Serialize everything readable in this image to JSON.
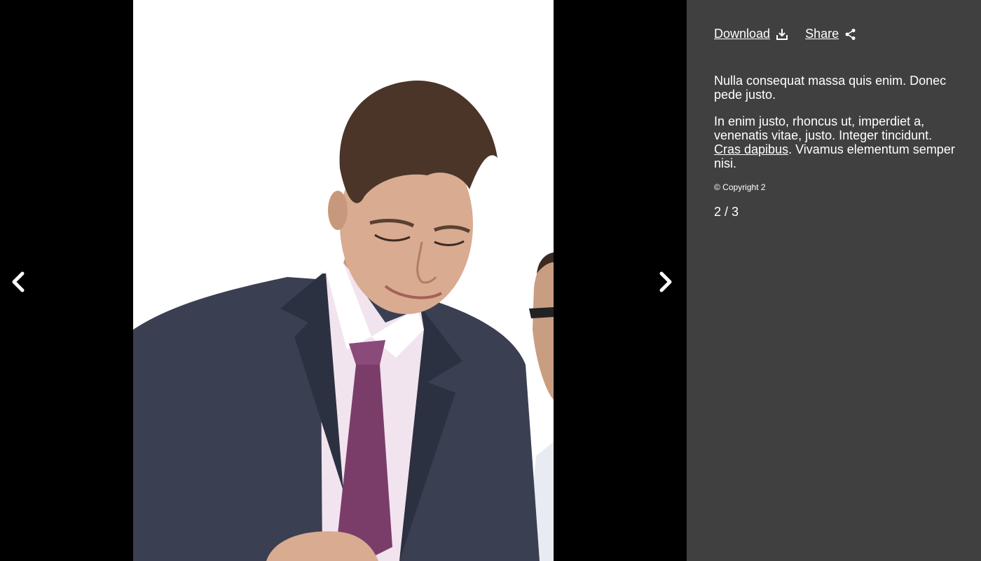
{
  "actions": {
    "download_label": "Download",
    "share_label": "Share"
  },
  "caption": {
    "paragraph1": "Nulla consequat massa quis enim. Donec pede justo.",
    "paragraph2_before": "In enim justo, rhoncus ut, imperdiet a, venenatis vitae, justo. Integer tincidunt.",
    "paragraph2_link": "Cras dapibus",
    "paragraph2_after": ". Vivamus elementum semper nisi."
  },
  "copyright": "© Copyright 2",
  "counter": "2 / 3",
  "icons": {
    "prev": "chevron-left-icon",
    "next": "chevron-right-icon",
    "download": "download-icon",
    "share": "share-icon"
  },
  "colors": {
    "panel_background": "#404040",
    "viewer_background": "#000000",
    "text": "#ffffff"
  }
}
